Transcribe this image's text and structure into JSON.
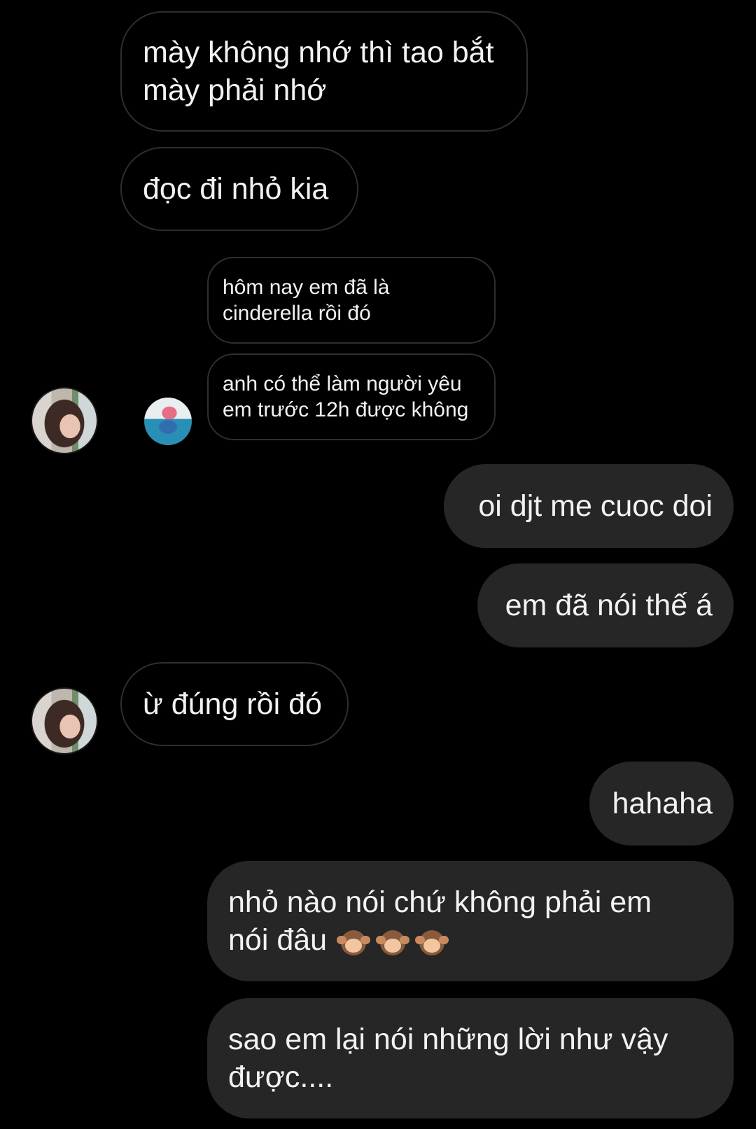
{
  "messages": [
    {
      "id": "m1",
      "side": "in",
      "text": "mày không nhớ thì tao bắt\nmày phải nhớ"
    },
    {
      "id": "m2",
      "side": "in",
      "text": "đọc đi nhỏ kia"
    },
    {
      "id": "m3",
      "side": "out",
      "text": "oi djt me cuoc doi"
    },
    {
      "id": "m4",
      "side": "out",
      "text": "em đã nói thế á"
    },
    {
      "id": "m5",
      "side": "in",
      "text": "ừ đúng rồi đó"
    },
    {
      "id": "m6",
      "side": "out",
      "text": "hahaha"
    },
    {
      "id": "m7",
      "side": "out",
      "text": "nhỏ nào nói chứ không phải em\nnói đâu"
    },
    {
      "id": "m8",
      "side": "out",
      "text": "sao em lại nói những lời như vậy\nđược...."
    }
  ],
  "quoted_story": {
    "lines": [
      "hôm nay em đã là\ncinderella rồi đó",
      "anh có thể làm người yêu\nem trước 12h được không"
    ]
  },
  "emoji": [
    "see-no-evil-monkey",
    "hear-no-evil-monkey",
    "speak-no-evil-monkey"
  ],
  "colors": {
    "background": "#000000",
    "incoming_border": "#2e2e2e",
    "outgoing_bg": "#262626",
    "text": "#f2f2f2"
  }
}
